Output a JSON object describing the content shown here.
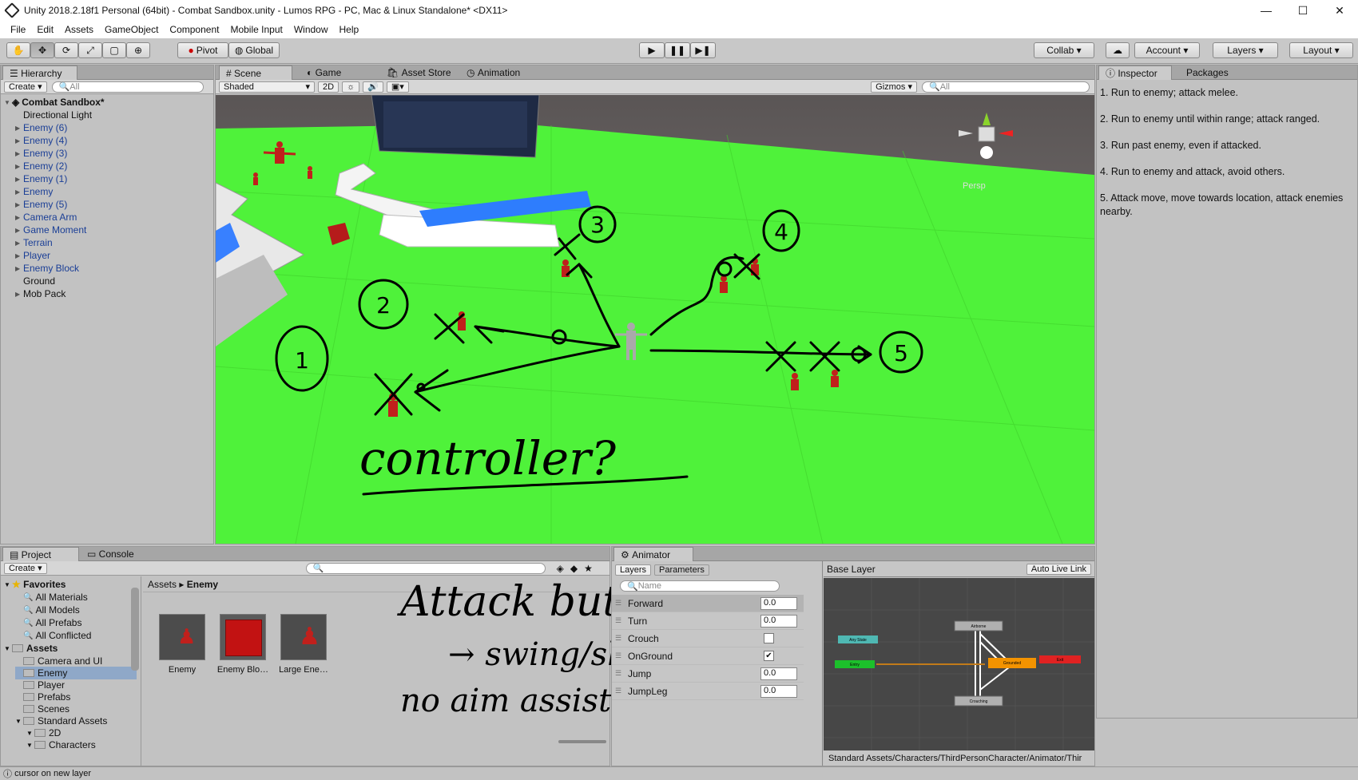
{
  "window": {
    "title": "Unity 2018.2.18f1 Personal (64bit) - Combat Sandbox.unity - Lumos RPG - PC, Mac & Linux Standalone* <DX11>",
    "controls": [
      "—",
      "☐",
      "✕"
    ]
  },
  "menu": [
    "File",
    "Edit",
    "Assets",
    "GameObject",
    "Component",
    "Mobile Input",
    "Window",
    "Help"
  ],
  "toolbar": {
    "pivot": "Pivot",
    "global": "Global",
    "collab": "Collab ▾",
    "account": "Account",
    "layers": "Layers",
    "layout": "Layout"
  },
  "hierarchy": {
    "tab": "Hierarchy",
    "create": "Create ▾",
    "search_placeholder": "All",
    "scene": "Combat Sandbox*",
    "items": [
      {
        "label": "Directional Light",
        "prefab": false,
        "expand": false
      },
      {
        "label": "Enemy (6)",
        "prefab": true,
        "expand": true
      },
      {
        "label": "Enemy (4)",
        "prefab": true,
        "expand": true
      },
      {
        "label": "Enemy (3)",
        "prefab": true,
        "expand": true
      },
      {
        "label": "Enemy (2)",
        "prefab": true,
        "expand": true
      },
      {
        "label": "Enemy (1)",
        "prefab": true,
        "expand": true
      },
      {
        "label": "Enemy",
        "prefab": true,
        "expand": true
      },
      {
        "label": "Enemy (5)",
        "prefab": true,
        "expand": true
      },
      {
        "label": "Camera Arm",
        "prefab": true,
        "expand": true
      },
      {
        "label": "Game Moment",
        "prefab": true,
        "expand": true
      },
      {
        "label": "Terrain",
        "prefab": true,
        "expand": true
      },
      {
        "label": "Player",
        "prefab": true,
        "expand": true
      },
      {
        "label": "Enemy Block",
        "prefab": true,
        "expand": true
      },
      {
        "label": "Ground",
        "prefab": false,
        "expand": false
      },
      {
        "label": "Mob Pack",
        "prefab": false,
        "expand": true
      }
    ]
  },
  "scene_tabs": [
    "Scene",
    "Game",
    "Asset Store",
    "Animation"
  ],
  "scene_bar": {
    "shading": "Shaded",
    "mode2d": "2D",
    "gizmos": "Gizmos",
    "search_placeholder": "All",
    "persp": "Persp"
  },
  "annotations": {
    "numbers": [
      "1",
      "2",
      "3",
      "4",
      "5"
    ],
    "controller": "controller?",
    "attack_note": [
      "Attack button",
      "→ swing/shoot",
      "no aim assist"
    ]
  },
  "inspector": {
    "tabs": [
      "Inspector",
      "Packages"
    ],
    "lines": [
      "1. Run to enemy; attack melee.",
      "2. Run to enemy until within range; attack ranged.",
      "3. Run past enemy, even if attacked.",
      "4. Run to enemy and attack, avoid others.",
      "5. Attack move, move towards location, attack enemies nearby."
    ]
  },
  "project": {
    "tabs": [
      "Project",
      "Console"
    ],
    "create": "Create ▾",
    "breadcrumb_root": "Assets",
    "breadcrumb_sep": "▸",
    "breadcrumb_leaf": "Enemy",
    "favorites_label": "Favorites",
    "favorites": [
      "All Materials",
      "All Models",
      "All Prefabs",
      "All Conflicted"
    ],
    "assets_label": "Assets",
    "folders": [
      {
        "label": "Camera and UI",
        "indent": 1,
        "selected": false,
        "expand": false
      },
      {
        "label": "Enemy",
        "indent": 1,
        "selected": true,
        "expand": false
      },
      {
        "label": "Player",
        "indent": 1,
        "selected": false,
        "expand": false
      },
      {
        "label": "Prefabs",
        "indent": 1,
        "selected": false,
        "expand": false
      },
      {
        "label": "Scenes",
        "indent": 1,
        "selected": false,
        "expand": false
      },
      {
        "label": "Standard Assets",
        "indent": 1,
        "selected": false,
        "expand": true
      },
      {
        "label": "2D",
        "indent": 2,
        "selected": false,
        "expand": true
      },
      {
        "label": "Characters",
        "indent": 2,
        "selected": false,
        "expand": true
      }
    ],
    "assets": [
      "Enemy",
      "Enemy Blo…",
      "Large Ene…"
    ]
  },
  "animator": {
    "tab": "Animator",
    "sub_tabs": [
      "Layers",
      "Parameters"
    ],
    "search_placeholder": "Name",
    "base_layer": "Base Layer",
    "auto_live": "Auto Live Link",
    "params": [
      {
        "name": "Forward",
        "kind": "float",
        "value": "0.0"
      },
      {
        "name": "Turn",
        "kind": "float",
        "value": "0.0"
      },
      {
        "name": "Crouch",
        "kind": "bool",
        "value": ""
      },
      {
        "name": "OnGround",
        "kind": "bool",
        "value": "✔"
      },
      {
        "name": "Jump",
        "kind": "float",
        "value": "0.0"
      },
      {
        "name": "JumpLeg",
        "kind": "float",
        "value": "0.0"
      }
    ],
    "nodes": [
      "Any State",
      "Entry",
      "Airborne",
      "Grounded",
      "Crouching",
      "Exit"
    ],
    "path": "Standard Assets/Characters/ThirdPersonCharacter/Animator/Thir"
  },
  "status": "cursor on new layer",
  "colors": {
    "grass": "#4ff23a",
    "prefab_text": "#1a3e96",
    "ink": "#000000"
  }
}
